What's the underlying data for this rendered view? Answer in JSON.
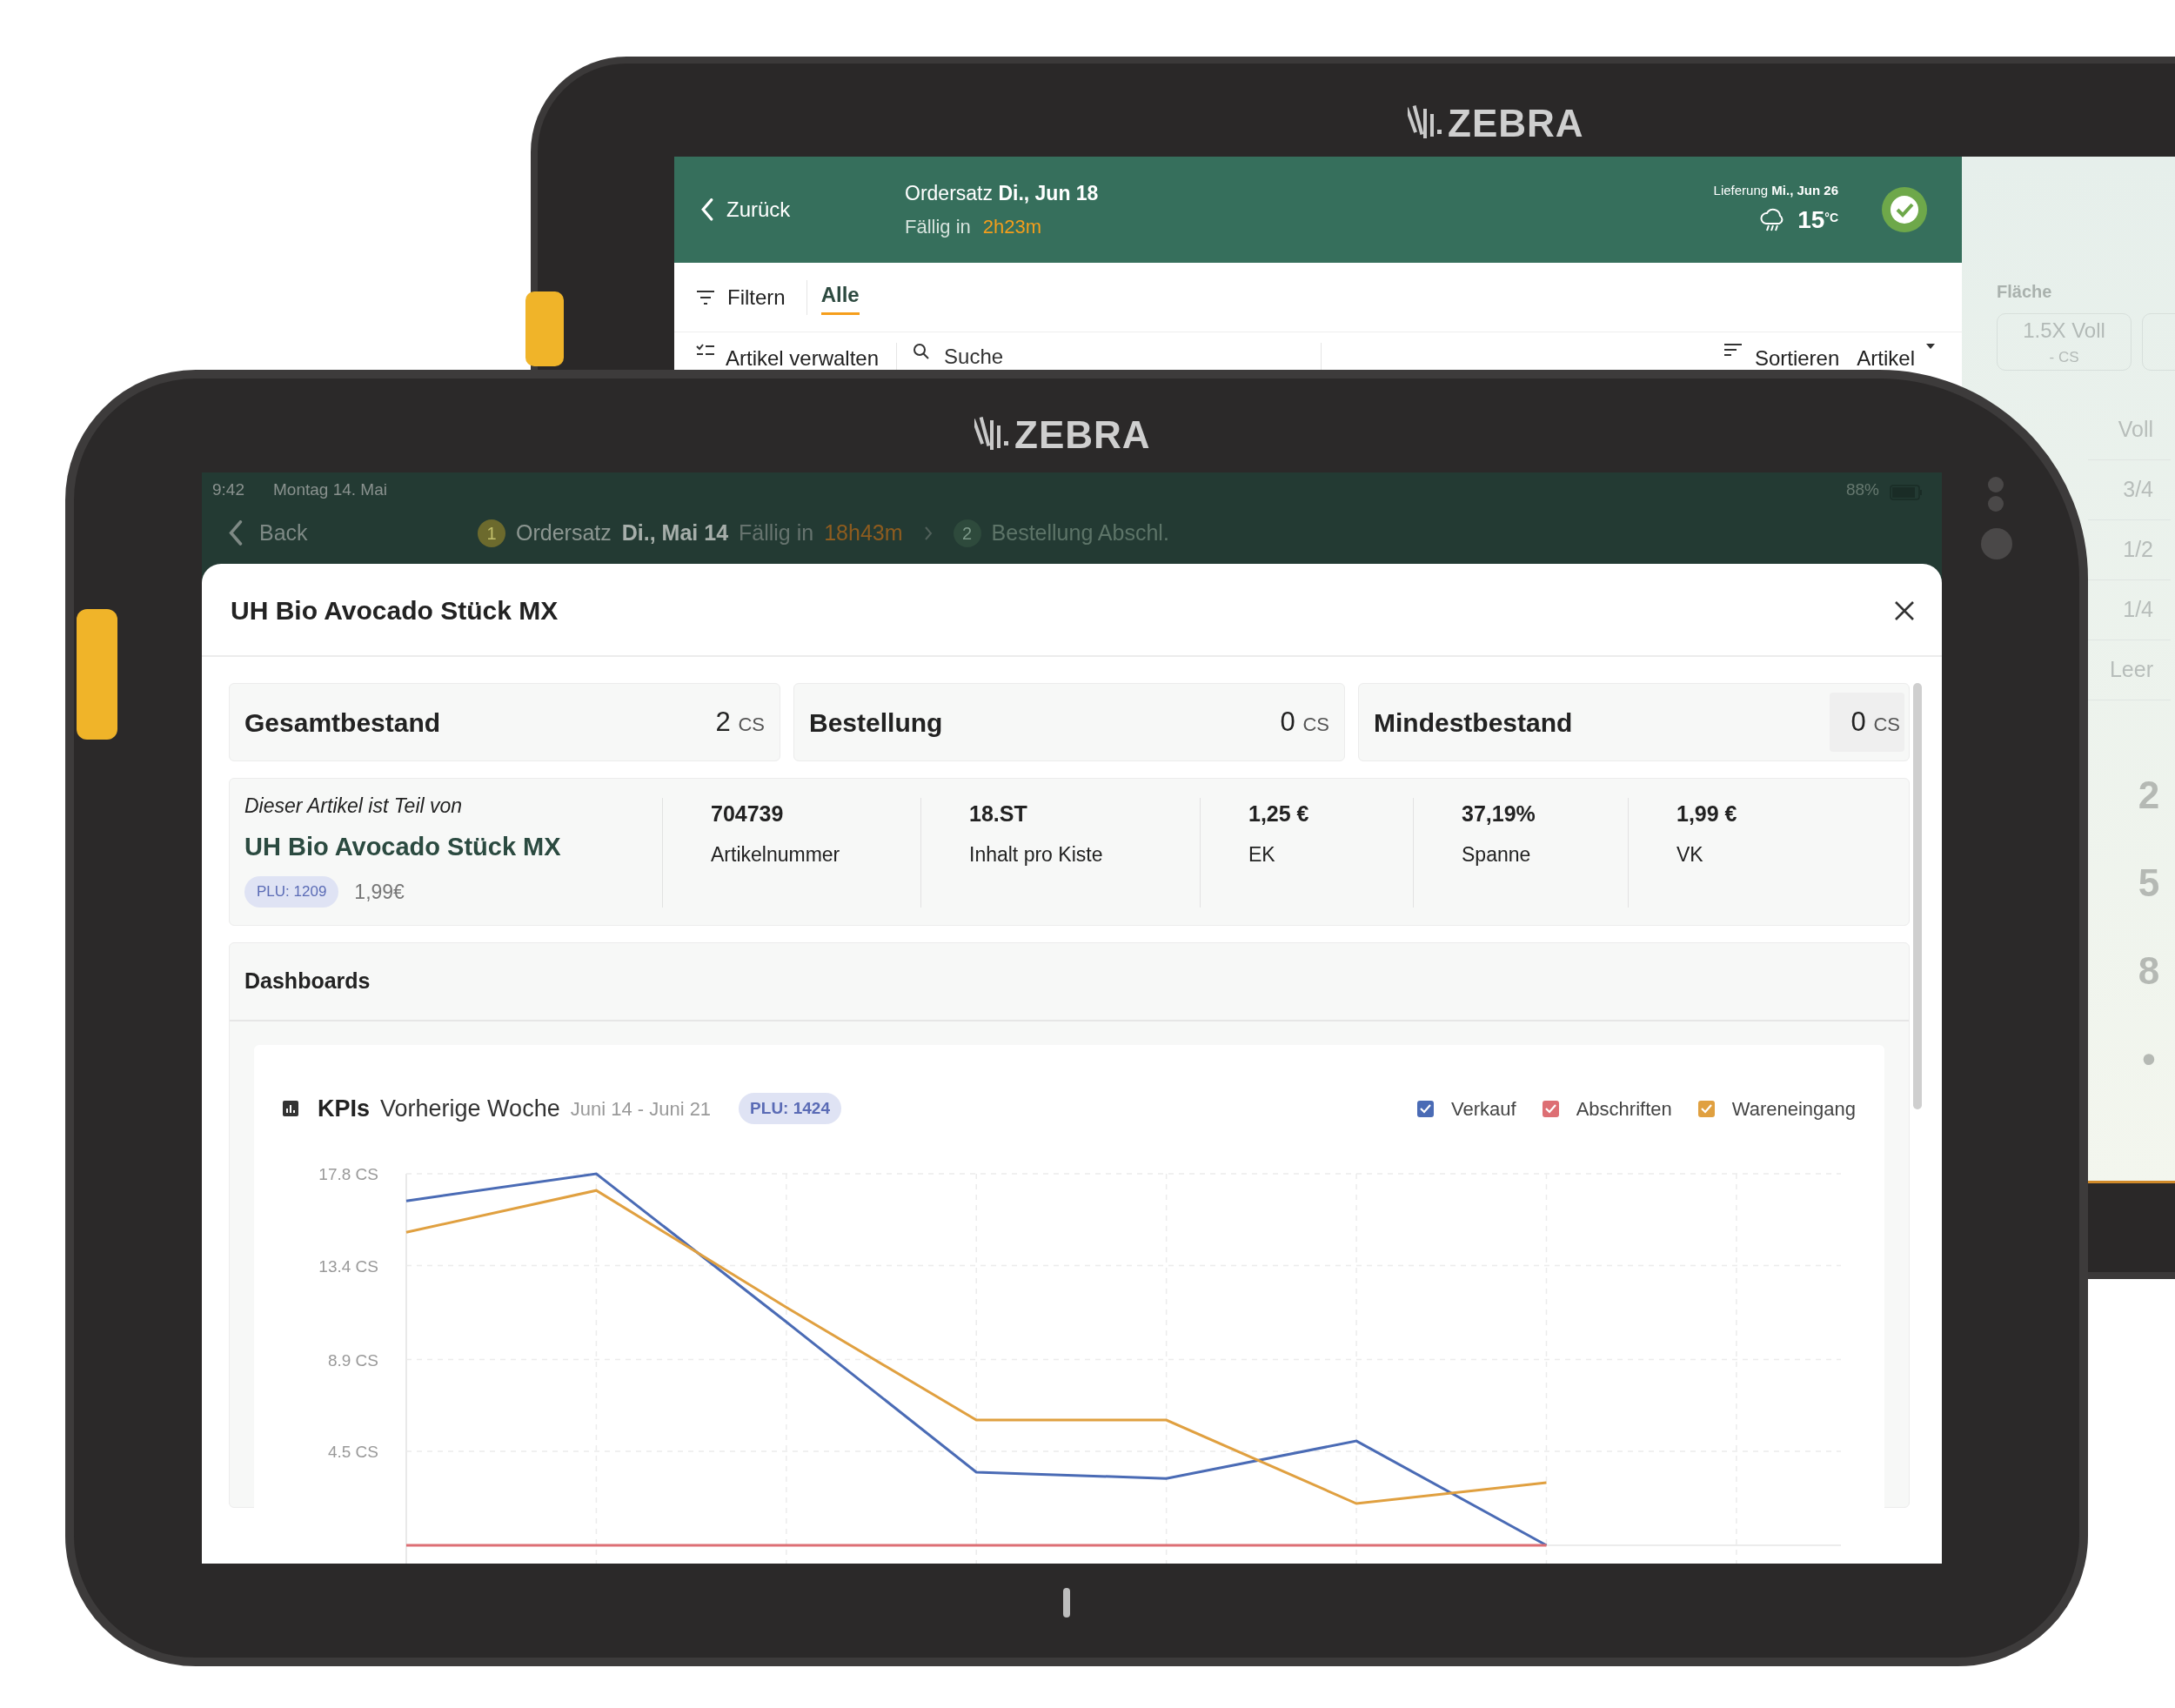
{
  "back_tablet": {
    "brand": "ZEBRA",
    "header": {
      "back": "Zurück",
      "order_label": "Ordersatz",
      "order_date": "Di., Jun 18",
      "due_label": "Fällig in",
      "due_time": "2h23m",
      "delivery_label": "Lieferung",
      "delivery_date": "Mi., Jun 26",
      "temperature": "15",
      "temperature_unit": "°C",
      "done": true
    },
    "filter": {
      "label": "Filtern",
      "tabs": [
        {
          "label": "Alle",
          "selected": true
        }
      ]
    },
    "toolbar": {
      "manage": "Artikel verwalten",
      "search_placeholder": "Suche",
      "sort": "Sortieren",
      "sort_value": "Artikel"
    },
    "side_panel": {
      "area_label": "Fläche",
      "area_options": [
        {
          "label": "1.5X Voll",
          "unit": "- CS"
        }
      ],
      "fill_levels": [
        "Voll",
        "3/4",
        "1/2",
        "1/4",
        "Leer"
      ],
      "keypad": [
        "2",
        "5",
        "8",
        "•"
      ]
    }
  },
  "front_tablet": {
    "brand": "ZEBRA",
    "status_bar": {
      "time": "9:42",
      "date": "Montag 14. Mai",
      "battery": "88%"
    },
    "nav": {
      "back": "Back",
      "steps": [
        {
          "number": "1",
          "label": "Ordersatz",
          "date": "Di., Mai 14",
          "due_label": "Fällig in",
          "due_time": "18h43m",
          "selected": true
        },
        {
          "number": "2",
          "label": "Bestellung Abschl.",
          "selected": false
        }
      ]
    },
    "modal": {
      "title": "UH Bio Avocado Stück MX",
      "stats": [
        {
          "kind": "display",
          "label": "Gesamtbestand",
          "value": "2",
          "unit": "CS"
        },
        {
          "kind": "display",
          "label": "Bestellung",
          "value": "0",
          "unit": "CS"
        },
        {
          "kind": "input",
          "label": "Mindestbestand",
          "value": "0",
          "unit": "CS"
        }
      ],
      "info": {
        "part_of": "Dieser Artikel ist Teil von",
        "parent": "UH Bio Avocado Stück MX",
        "plu": "PLU: 1209",
        "price": "1,99€",
        "facts": [
          {
            "value": "704739",
            "label": "Artikelnummer"
          },
          {
            "value": "18.ST",
            "label": "Inhalt pro Kiste"
          },
          {
            "value": "1,25 €",
            "label": "EK"
          },
          {
            "value": "37,19%",
            "label": "Spanne"
          },
          {
            "value": "1,99 €",
            "label": "VK"
          }
        ]
      },
      "dashboards": {
        "title": "Dashboards",
        "kpi": {
          "title": "KPIs",
          "period": "Vorherige Woche",
          "range": "Juni 14 - Juni 21",
          "plu": "PLU: 1424",
          "legend": [
            {
              "checked": true
            },
            {
              "checked": true
            },
            {
              "checked": true
            }
          ],
          "chart_data": {
            "type": "line",
            "categories": [
              null,
              null,
              null,
              null,
              null,
              null,
              null
            ],
            "grid": true,
            "ylim": [
              0,
              17.8
            ],
            "yticks": [
              {
                "value": 17.8,
                "label": "17.8 CS"
              },
              {
                "value": 13.4,
                "label": "13.4 CS"
              },
              {
                "value": 8.9,
                "label": "8.9 CS"
              },
              {
                "value": 4.5,
                "label": "4.5 CS"
              }
            ],
            "series": [
              {
                "name": "Verkauf",
                "color": "#4a6bb5",
                "values": [
                  16.5,
                  17.8,
                  10.7,
                  3.5,
                  3.2,
                  5.0,
                  0
                ]
              },
              {
                "name": "Abschriften",
                "color": "#dd6f74",
                "values": [
                  0,
                  0,
                  0,
                  0,
                  0,
                  0,
                  0
                ]
              },
              {
                "name": "Wareneingang",
                "color": "#e0a040",
                "values": [
                  15.0,
                  17.0,
                  11.4,
                  6.0,
                  6.0,
                  2.0,
                  3.0
                ]
              }
            ]
          }
        }
      }
    }
  }
}
